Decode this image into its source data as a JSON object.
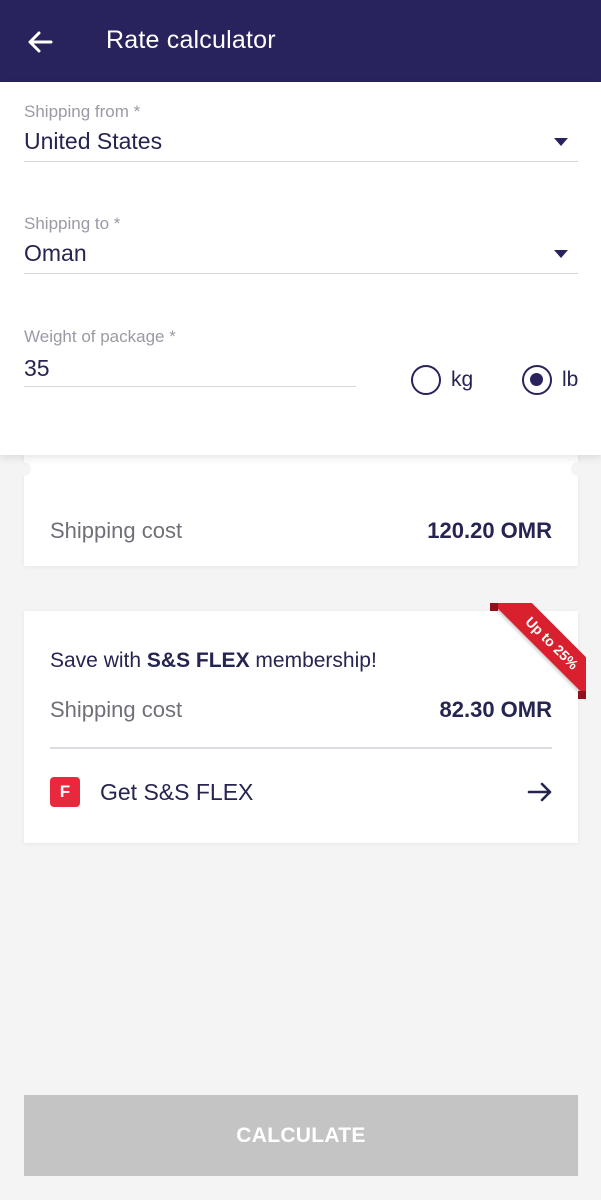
{
  "appbar": {
    "title": "Rate calculator",
    "back_icon": "arrow-left-icon",
    "background": "#28235c"
  },
  "form": {
    "from": {
      "label": "Shipping from *",
      "value": "United States"
    },
    "to": {
      "label": "Shipping to *",
      "value": "Oman"
    },
    "weight": {
      "label": "Weight of package *",
      "value": "35",
      "units": [
        {
          "label": "kg",
          "selected": false
        },
        {
          "label": "lb",
          "selected": true
        }
      ]
    }
  },
  "result": {
    "cost_label": "Shipping cost",
    "cost_value": "120.20 OMR"
  },
  "flex": {
    "ribbon": "Up to 25%",
    "save_prefix": "Save with ",
    "save_brand": "S&S FLEX",
    "save_suffix": " membership!",
    "cost_label": "Shipping cost",
    "cost_value": "82.30 OMR",
    "badge": "F",
    "link_label": "Get S&S FLEX",
    "badge_color": "#e8293d",
    "ribbon_color": "#d8202e"
  },
  "actions": {
    "calculate_label": "CALCULATE",
    "calculate_disabled_color": "#c4c4c4"
  }
}
